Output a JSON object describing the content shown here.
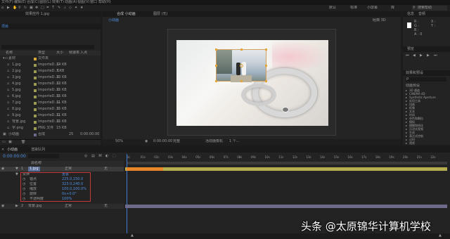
{
  "menubar": {
    "items": [
      "文件(F)",
      "编辑(E)",
      "合成(C)",
      "图层(L)",
      "效果(T)",
      "动画(A)",
      "视图(V)",
      "窗口",
      "帮助(H)"
    ],
    "workspaces": [
      "默认",
      "标准",
      "小屏幕",
      "库"
    ],
    "search_placeholder": "搜索帮助"
  },
  "project": {
    "effect_controls_tab": "效果控件 1.jpg",
    "tab": "项目",
    "columns": [
      "名称",
      "类型",
      "大小",
      "帧速率",
      "入点"
    ],
    "items": [
      {
        "name": "素材",
        "type": "文件夹",
        "size": "",
        "fps": "",
        "in": ""
      },
      {
        "name": "1.jpg",
        "type": "ImporteD..G",
        "size": "14 KB",
        "fps": "",
        "in": ""
      },
      {
        "name": "2.jpg",
        "type": "ImporteD..G",
        "size": "7 KB",
        "fps": "",
        "in": ""
      },
      {
        "name": "3.jpg",
        "type": "ImporteD..G",
        "size": "10 KB",
        "fps": "",
        "in": ""
      },
      {
        "name": "4.jpg",
        "type": "ImporteD..G",
        "size": "13 KB",
        "fps": "",
        "in": ""
      },
      {
        "name": "5.jpg",
        "type": "ImporteD..G",
        "size": "15 KB",
        "fps": "",
        "in": ""
      },
      {
        "name": "6.jpg",
        "type": "ImporteD..G",
        "size": "15 KB",
        "fps": "",
        "in": ""
      },
      {
        "name": "7.jpg",
        "type": "ImporteD..G",
        "size": "11 KB",
        "fps": "",
        "in": ""
      },
      {
        "name": "8.jpg",
        "type": "ImporteD..G",
        "size": "15 KB",
        "fps": "",
        "in": ""
      },
      {
        "name": "9.jpg",
        "type": "ImporteD..G",
        "size": "11 KB",
        "fps": "",
        "in": ""
      },
      {
        "name": "背景.jpg",
        "type": "ImporteD..G",
        "size": "15 KB",
        "fps": "",
        "in": ""
      },
      {
        "name": "字.png",
        "type": "PNG 文件",
        "size": "15 KB",
        "fps": "",
        "in": ""
      },
      {
        "name": "小动画",
        "type": "合成",
        "size": "",
        "fps": "25",
        "in": "0:00:00:00"
      }
    ]
  },
  "composition": {
    "tab": "合成 小动画",
    "layer_tab": "图层 (无)",
    "breadcrumb": "小动画",
    "renderer": "经典 3D",
    "zoom": "50%",
    "resolution": "完整",
    "camera": "活动摄像机",
    "views": "1 个...",
    "timecode": "0:00:00:00"
  },
  "right_panel": {
    "info_tab": "信息",
    "audio_tab": "音频",
    "preview_tab": "预览",
    "effects_tab": "效果和预设",
    "search_placeholder": "ρ",
    "preset_label": "动画预设",
    "effect_categories": [
      "3D 通道",
      "CINEMA 4D",
      "Synthetic Aperture",
      "实用工具",
      "扭曲",
      "抠像",
      "文本",
      "时间",
      "杂色和颗粒",
      "模拟",
      "模糊和锐化",
      "沉浸式视频",
      "生成",
      "表达式控制",
      "过时",
      "透视"
    ]
  },
  "timeline": {
    "tab": "小动画",
    "render_tab": "渲染队列",
    "timecode": "0:00:00:00",
    "column_header": "源名称",
    "layer1": {
      "index": "1",
      "name": "1.jpg",
      "mode": "正常",
      "parent": "无"
    },
    "transform_label": "变换",
    "reset_label": "重置",
    "properties": [
      {
        "name": "锚点",
        "value": "225.0,150.0"
      },
      {
        "name": "位置",
        "value": "323.0,240.0"
      },
      {
        "name": "缩放",
        "value": "100.0,100.0%"
      },
      {
        "name": "旋转",
        "value": "0x+0.0°"
      },
      {
        "name": "不透明度",
        "value": "100%"
      }
    ],
    "layer2": {
      "index": "2",
      "name": "背景.jpg",
      "mode": "正常",
      "parent": "无"
    },
    "ruler_marks": [
      "0s",
      "01s",
      "02s",
      "03s",
      "04s",
      "05s",
      "06s",
      "07s",
      "08s",
      "09s",
      "10s",
      "11s",
      "12s",
      "13s",
      "14s",
      "15s",
      "16s",
      "17s",
      "18s",
      "19s",
      "20s",
      "21s",
      "22s"
    ]
  },
  "watermark": "头条 @太原锦华计算机学校",
  "colors": {
    "accent": "#4d8fe0",
    "track": "#b6ae4e",
    "work_area": "#e8862a"
  }
}
